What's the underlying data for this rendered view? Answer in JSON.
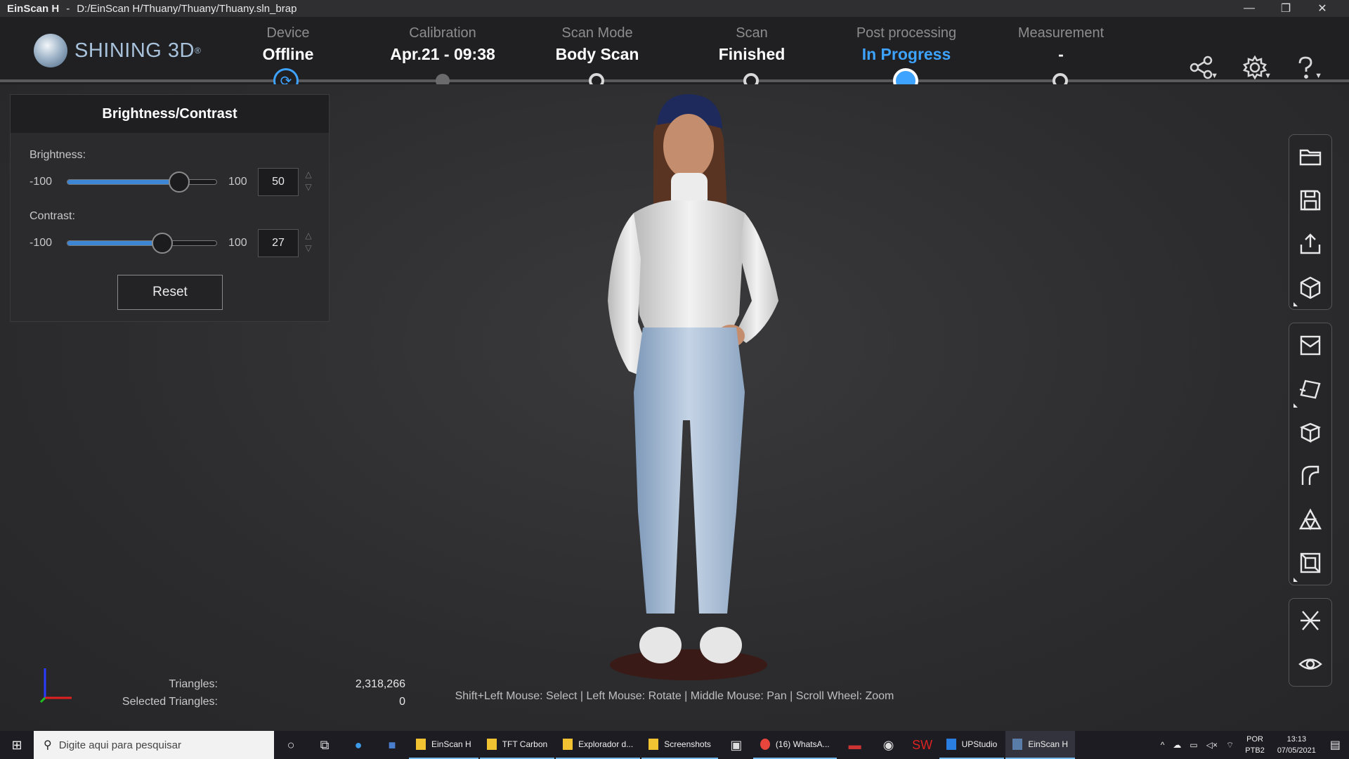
{
  "window": {
    "app_name": "EinScan H",
    "separator": "-",
    "path": "D:/EinScan H/Thuany/Thuany/Thuany.sln_brap",
    "controls": [
      "—",
      "❐",
      "✕"
    ]
  },
  "logo": {
    "text": "SHINING 3D",
    "mark": "®"
  },
  "steps": [
    {
      "label": "Device",
      "value": "Offline"
    },
    {
      "label": "Calibration",
      "value": "Apr.21 - 09:38"
    },
    {
      "label": "Scan Mode",
      "value": "Body Scan"
    },
    {
      "label": "Scan",
      "value": "Finished"
    },
    {
      "label": "Post processing",
      "value": "In Progress"
    },
    {
      "label": "Measurement",
      "value": "-"
    }
  ],
  "header_icons": [
    "share-icon",
    "gear-icon",
    "help-icon"
  ],
  "panel": {
    "title": "Brightness/Contrast",
    "brightness": {
      "label": "Brightness:",
      "min": "-100",
      "max": "100",
      "value": "50",
      "fraction": 0.75
    },
    "contrast": {
      "label": "Contrast:",
      "min": "-100",
      "max": "100",
      "value": "27",
      "fraction": 0.635
    },
    "reset_label": "Reset"
  },
  "stats": {
    "triangles_label": "Triangles:",
    "triangles_value": "2,318,266",
    "selected_label": "Selected Triangles:",
    "selected_value": "0"
  },
  "hint": "Shift+Left Mouse: Select | Left Mouse: Rotate | Middle Mouse: Pan | Scroll Wheel: Zoom",
  "toolbar_groups": [
    [
      "open-folder-icon",
      "save-icon",
      "export-icon",
      "cube-view-icon"
    ],
    [
      "mesh-box-icon",
      "plane-cut-icon",
      "box-icon",
      "curve-icon",
      "triangle-mesh-icon",
      "frame-icon"
    ],
    [
      "align-icon",
      "eye-icon"
    ]
  ],
  "taskbar": {
    "search_placeholder": "Digite aqui para pesquisar",
    "apps": [
      "EinScan H",
      "TFT Carbon",
      "Explorador d...",
      "Screenshots",
      "(16) WhatsA...",
      "UPStudio",
      "EinScan H"
    ],
    "lang_top": "POR",
    "lang_bottom": "PTB2",
    "time": "13:13",
    "date": "07/05/2021"
  },
  "colors": {
    "accent": "#3ea2ff",
    "slider": "#3d86d6",
    "header_bg": "#202022",
    "viewport_bg": "#2c2c2e"
  }
}
